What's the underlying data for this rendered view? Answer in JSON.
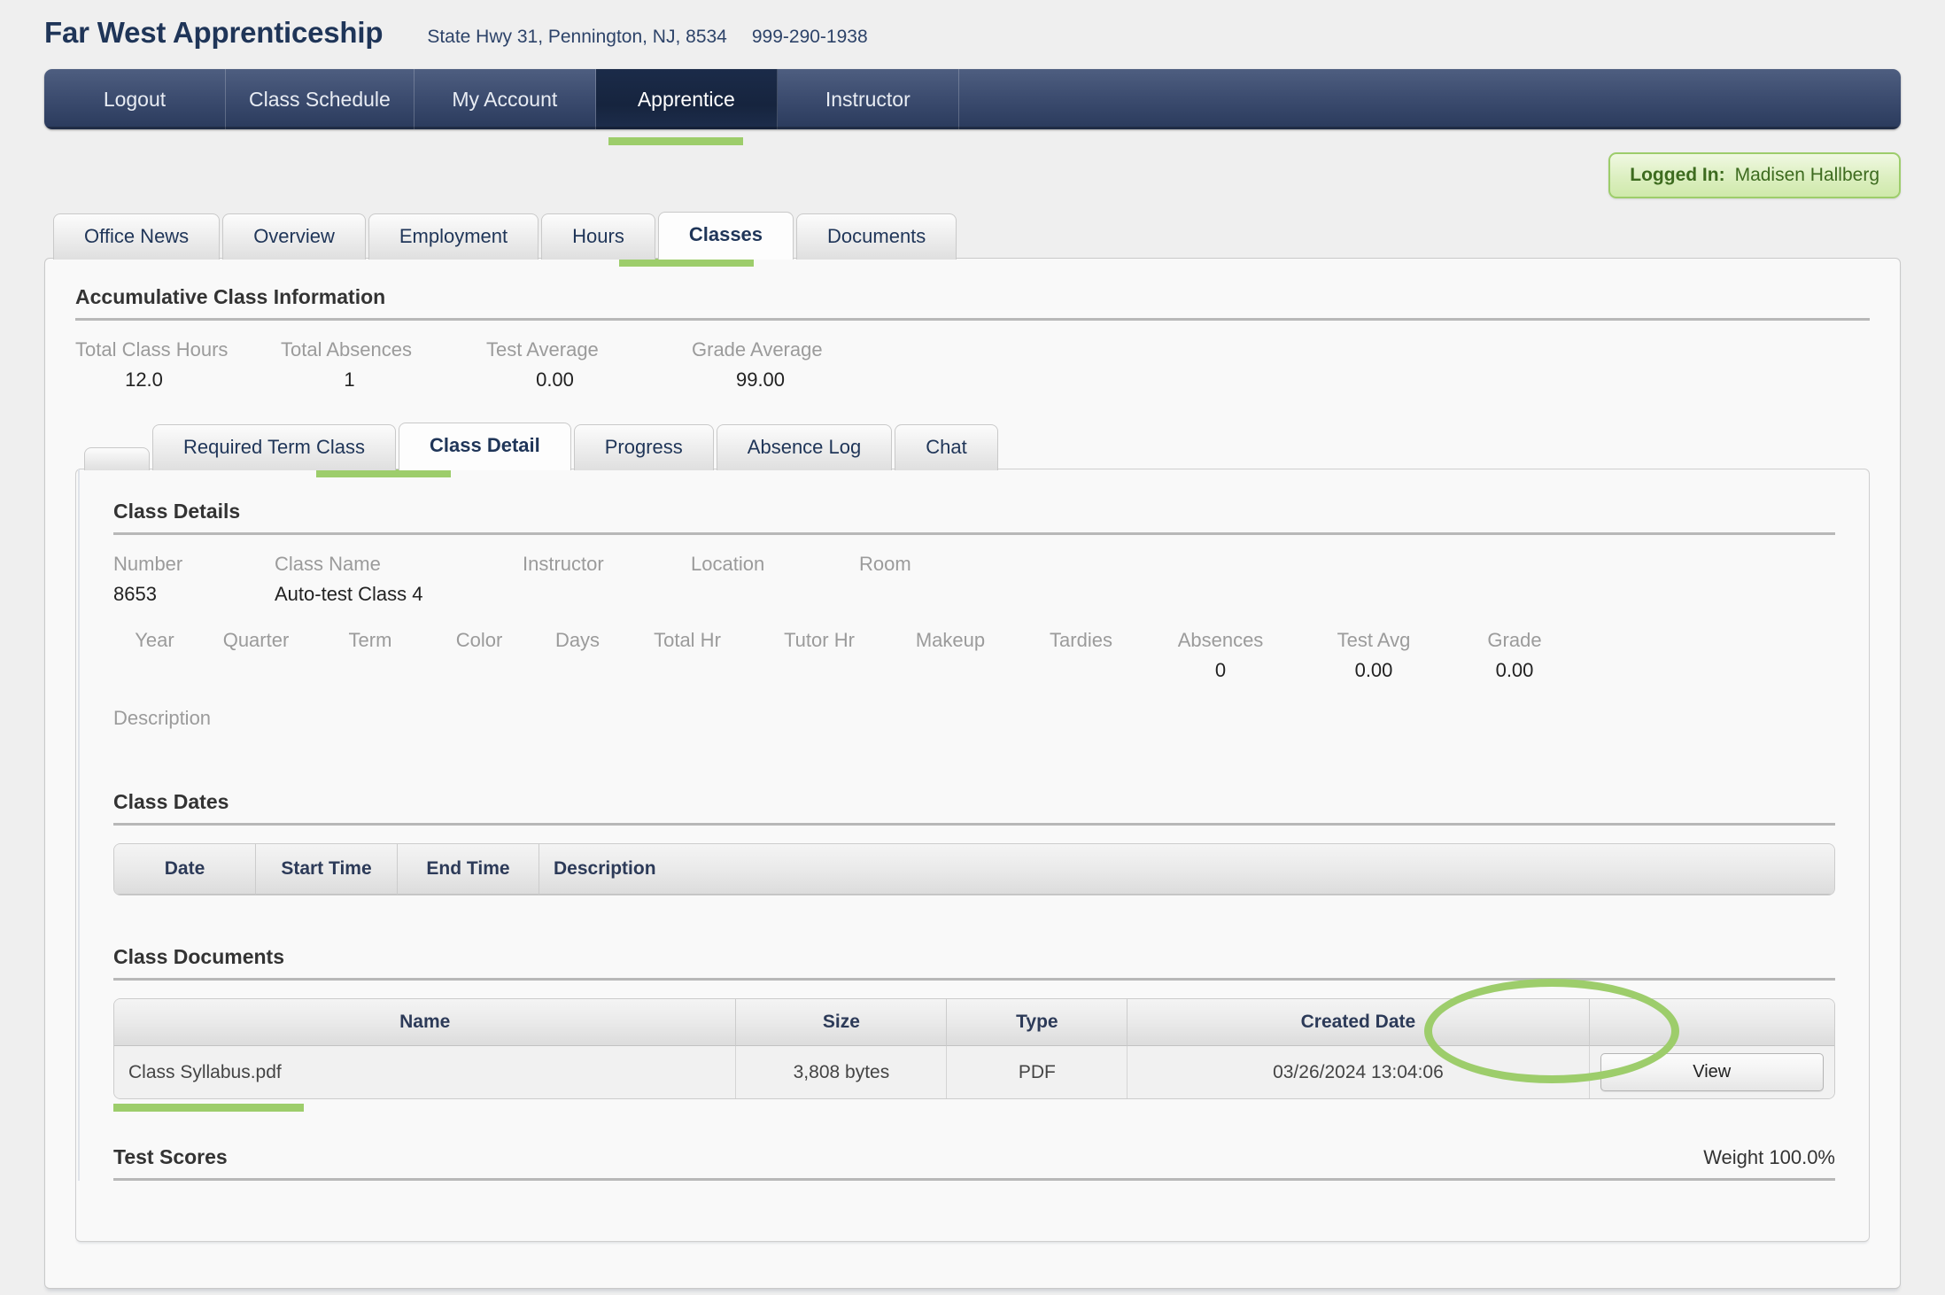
{
  "header": {
    "brand": "Far West Apprenticeship",
    "address": "State Hwy 31, Pennington, NJ, 8534",
    "phone": "999-290-1938"
  },
  "main_nav": {
    "items": [
      {
        "label": "Logout",
        "active": false
      },
      {
        "label": "Class Schedule",
        "active": false
      },
      {
        "label": "My Account",
        "active": false
      },
      {
        "label": "Apprentice",
        "active": true
      },
      {
        "label": "Instructor",
        "active": false
      }
    ]
  },
  "logged_in": {
    "label": "Logged In:",
    "user": "Madisen Hallberg"
  },
  "primary_tabs": [
    {
      "label": "Office News",
      "active": false
    },
    {
      "label": "Overview",
      "active": false
    },
    {
      "label": "Employment",
      "active": false
    },
    {
      "label": "Hours",
      "active": false
    },
    {
      "label": "Classes",
      "active": true
    },
    {
      "label": "Documents",
      "active": false
    }
  ],
  "accumulative": {
    "title": "Accumulative Class Information",
    "stats": [
      {
        "label": "Total Class Hours",
        "value": "12.0"
      },
      {
        "label": "Total Absences",
        "value": "1"
      },
      {
        "label": "Test Average",
        "value": "0.00"
      },
      {
        "label": "Grade Average",
        "value": "99.00"
      }
    ]
  },
  "inner_tabs": [
    {
      "label": "",
      "active": false
    },
    {
      "label": "Required Term Class",
      "active": false
    },
    {
      "label": "Class Detail",
      "active": true
    },
    {
      "label": "Progress",
      "active": false
    },
    {
      "label": "Absence Log",
      "active": false
    },
    {
      "label": "Chat",
      "active": false
    }
  ],
  "class_details": {
    "title": "Class Details",
    "row1": [
      {
        "label": "Number",
        "value": "8653"
      },
      {
        "label": "Class Name",
        "value": "Auto-test Class 4"
      },
      {
        "label": "Instructor",
        "value": ""
      },
      {
        "label": "Location",
        "value": ""
      },
      {
        "label": "Room",
        "value": ""
      }
    ],
    "row2": [
      {
        "label": "Year",
        "value": ""
      },
      {
        "label": "Quarter",
        "value": ""
      },
      {
        "label": "Term",
        "value": ""
      },
      {
        "label": "Color",
        "value": ""
      },
      {
        "label": "Days",
        "value": ""
      },
      {
        "label": "Total Hr",
        "value": ""
      },
      {
        "label": "Tutor Hr",
        "value": ""
      },
      {
        "label": "Makeup",
        "value": ""
      },
      {
        "label": "Tardies",
        "value": ""
      },
      {
        "label": "Absences",
        "value": "0"
      },
      {
        "label": "Test Avg",
        "value": "0.00"
      },
      {
        "label": "Grade",
        "value": "0.00"
      }
    ],
    "description_label": "Description",
    "description_value": ""
  },
  "class_dates": {
    "title": "Class Dates",
    "columns": [
      "Date",
      "Start Time",
      "End Time",
      "Description"
    ],
    "rows": []
  },
  "class_documents": {
    "title": "Class Documents",
    "columns": [
      "Name",
      "Size",
      "Type",
      "Created Date",
      ""
    ],
    "rows": [
      {
        "name": "Class Syllabus.pdf",
        "size": "3,808 bytes",
        "type": "PDF",
        "created_date": "03/26/2024 13:04:06",
        "action": "View"
      }
    ]
  },
  "test_scores": {
    "title": "Test Scores",
    "weight": "Weight 100.0%"
  },
  "colors": {
    "accent_green": "#9dcd6b",
    "nav_dark": "#2a3a5c",
    "nav_active": "#1b2b49",
    "brand_navy": "#1f3558"
  }
}
